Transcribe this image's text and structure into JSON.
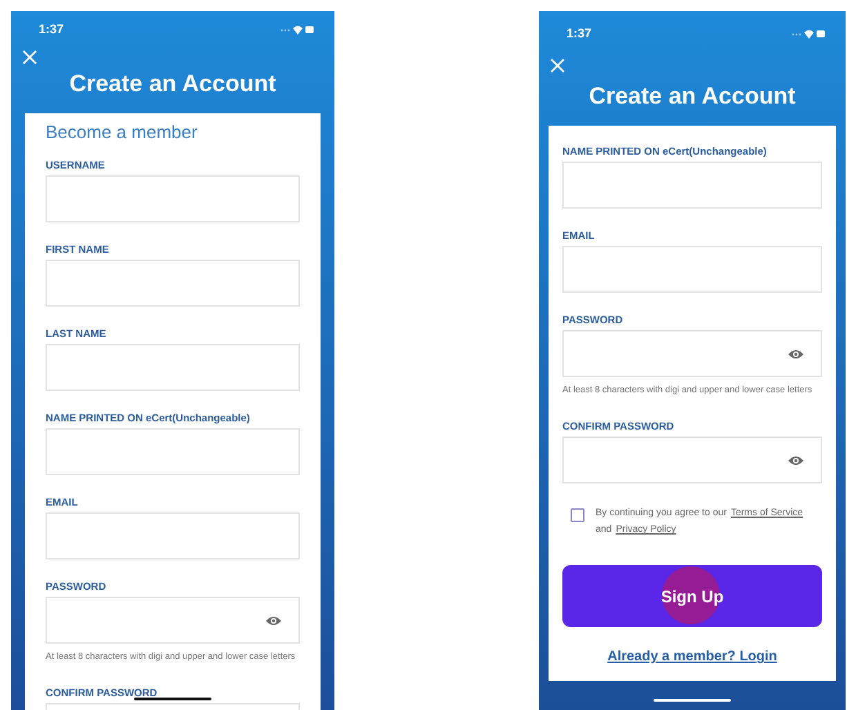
{
  "screens": [
    {
      "status_time": "1:37",
      "title": "Create an Account",
      "items": [
        {
          "kind": "heading",
          "text": "Become a member"
        },
        {
          "kind": "field",
          "label": "USERNAME",
          "password": false
        },
        {
          "kind": "field",
          "label": "FIRST NAME",
          "password": false
        },
        {
          "kind": "field",
          "label": "LAST NAME",
          "password": false
        },
        {
          "kind": "field",
          "label": "NAME PRINTED ON eCert(Unchangeable)",
          "password": false
        },
        {
          "kind": "field",
          "label": "EMAIL",
          "password": false
        },
        {
          "kind": "field",
          "label": "PASSWORD",
          "password": true
        },
        {
          "kind": "hint",
          "text": "At least 8 characters with digi and upper and lower case letters"
        },
        {
          "kind": "field",
          "label": "CONFIRM PASSWORD"
        }
      ]
    },
    {
      "status_time": "1:37",
      "title": "Create an Account",
      "items": [
        {
          "kind": "field",
          "label": "NAME PRINTED ON eCert(Unchangeable)",
          "password": false
        },
        {
          "kind": "field",
          "label": "EMAIL",
          "password": false
        },
        {
          "kind": "field",
          "label": "PASSWORD",
          "password": true
        },
        {
          "kind": "hint",
          "text": "At least 8 characters with digi and upper and lower case letters"
        },
        {
          "kind": "field",
          "label": "CONFIRM PASSWORD",
          "password": true
        },
        {
          "kind": "agreement",
          "checked": false,
          "parts": [
            {
              "text": "By continuing you agree to our",
              "link": false
            },
            {
              "text": "Terms of Service",
              "link": true
            },
            {
              "text": "and",
              "link": false
            },
            {
              "text": "Privacy Policy",
              "link": true
            }
          ]
        },
        {
          "kind": "button",
          "label": "Sign Up",
          "touched": true
        },
        {
          "kind": "link",
          "text": "Already a member? Login"
        }
      ]
    }
  ]
}
